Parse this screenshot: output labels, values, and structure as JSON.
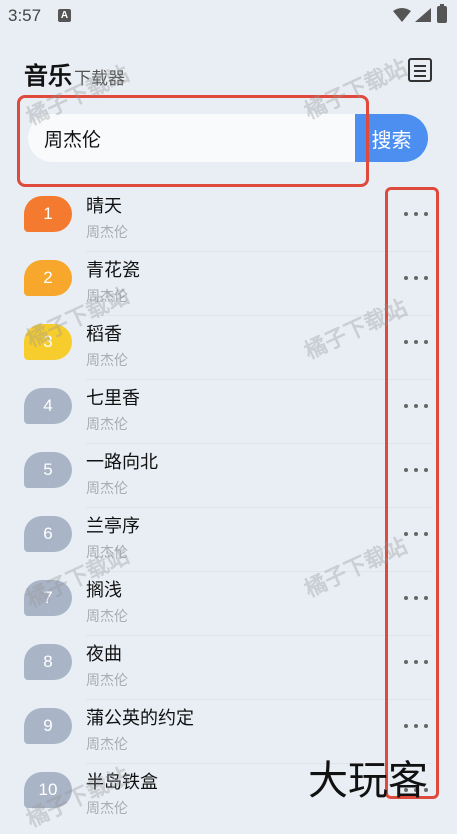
{
  "status_bar": {
    "time": "3:57",
    "notification_letter": "A"
  },
  "header": {
    "title": "音乐",
    "subtitle": "下载器"
  },
  "search": {
    "value": "周杰伦",
    "button_label": "搜索"
  },
  "songs": [
    {
      "index": "1",
      "title": "晴天",
      "artist": "周杰伦",
      "badge_color": "#f47a2f"
    },
    {
      "index": "2",
      "title": "青花瓷",
      "artist": "周杰伦",
      "badge_color": "#f6a72c"
    },
    {
      "index": "3",
      "title": "稻香",
      "artist": "周杰伦",
      "badge_color": "#f7cd2e"
    },
    {
      "index": "4",
      "title": "七里香",
      "artist": "周杰伦",
      "badge_color": "#a9b4c7"
    },
    {
      "index": "5",
      "title": "一路向北",
      "artist": "周杰伦",
      "badge_color": "#a9b4c7"
    },
    {
      "index": "6",
      "title": "兰亭序",
      "artist": "周杰伦",
      "badge_color": "#a9b4c7"
    },
    {
      "index": "7",
      "title": "搁浅",
      "artist": "周杰伦",
      "badge_color": "#a9b4c7"
    },
    {
      "index": "8",
      "title": "夜曲",
      "artist": "周杰伦",
      "badge_color": "#a9b4c7"
    },
    {
      "index": "9",
      "title": "蒲公英的约定",
      "artist": "周杰伦",
      "badge_color": "#a9b4c7"
    },
    {
      "index": "10",
      "title": "半岛铁盒",
      "artist": "周杰伦",
      "badge_color": "#a9b4c7"
    }
  ],
  "icons": {
    "more": "more-dots-icon",
    "menu": "swap-menu-icon",
    "wifi": "wifi-icon",
    "signal": "signal-icon",
    "battery": "battery-icon"
  },
  "watermark_text": "橘子下载站",
  "brand_logo_text": "大玩客",
  "colors": {
    "accent": "#4c8ff0",
    "highlight_box": "#e04a3c",
    "background": "#e8eef4"
  }
}
